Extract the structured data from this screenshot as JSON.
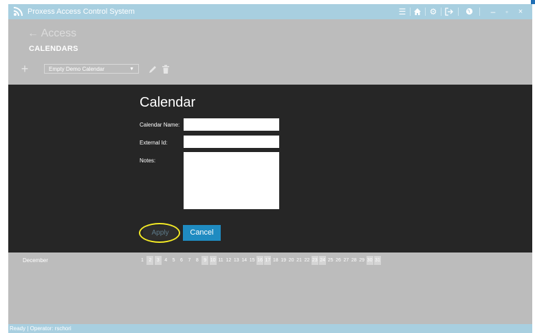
{
  "app": {
    "title": "Proxess Access Control System",
    "toolbar_icons": [
      "menu-icon",
      "home-icon",
      "gear-icon",
      "logout-icon",
      "globe-icon",
      "minimize-icon",
      "maximize-icon",
      "close-icon"
    ]
  },
  "nav": {
    "back_label": "Access",
    "page_heading": "CALENDARS"
  },
  "toolbar": {
    "add_symbol": "+",
    "calendar_select_value": "Empty Demo Calendar"
  },
  "form": {
    "title": "Calendar",
    "calendar_name_label": "Calendar Name:",
    "calendar_name_value": "",
    "external_id_label": "External Id:",
    "external_id_value": "",
    "notes_label": "Notes:",
    "notes_value": "",
    "apply_label": "Apply",
    "cancel_label": "Cancel"
  },
  "calendar_strip": {
    "month": "December",
    "days": [
      {
        "n": "1",
        "shaded": false
      },
      {
        "n": "2",
        "shaded": true
      },
      {
        "n": "3",
        "shaded": true
      },
      {
        "n": "4",
        "shaded": false
      },
      {
        "n": "5",
        "shaded": false
      },
      {
        "n": "6",
        "shaded": false
      },
      {
        "n": "7",
        "shaded": false
      },
      {
        "n": "8",
        "shaded": false
      },
      {
        "n": "9",
        "shaded": true
      },
      {
        "n": "10",
        "shaded": true
      },
      {
        "n": "11",
        "shaded": false
      },
      {
        "n": "12",
        "shaded": false
      },
      {
        "n": "13",
        "shaded": false
      },
      {
        "n": "14",
        "shaded": false
      },
      {
        "n": "15",
        "shaded": false
      },
      {
        "n": "16",
        "shaded": true
      },
      {
        "n": "17",
        "shaded": true
      },
      {
        "n": "18",
        "shaded": false
      },
      {
        "n": "19",
        "shaded": false
      },
      {
        "n": "20",
        "shaded": false
      },
      {
        "n": "21",
        "shaded": false
      },
      {
        "n": "22",
        "shaded": false
      },
      {
        "n": "23",
        "shaded": true
      },
      {
        "n": "24",
        "shaded": true
      },
      {
        "n": "25",
        "shaded": false
      },
      {
        "n": "26",
        "shaded": false
      },
      {
        "n": "27",
        "shaded": false
      },
      {
        "n": "28",
        "shaded": false
      },
      {
        "n": "29",
        "shaded": false
      },
      {
        "n": "30",
        "shaded": true
      },
      {
        "n": "31",
        "shaded": true
      }
    ]
  },
  "status": {
    "text": "Ready | Operator: rschori"
  },
  "colors": {
    "titlebar": "#a8cfe0",
    "window_bg": "#bcbcbc",
    "form_panel": "#262626",
    "accent_button": "#1f8bc1",
    "highlight_ring": "#f4ea25"
  }
}
